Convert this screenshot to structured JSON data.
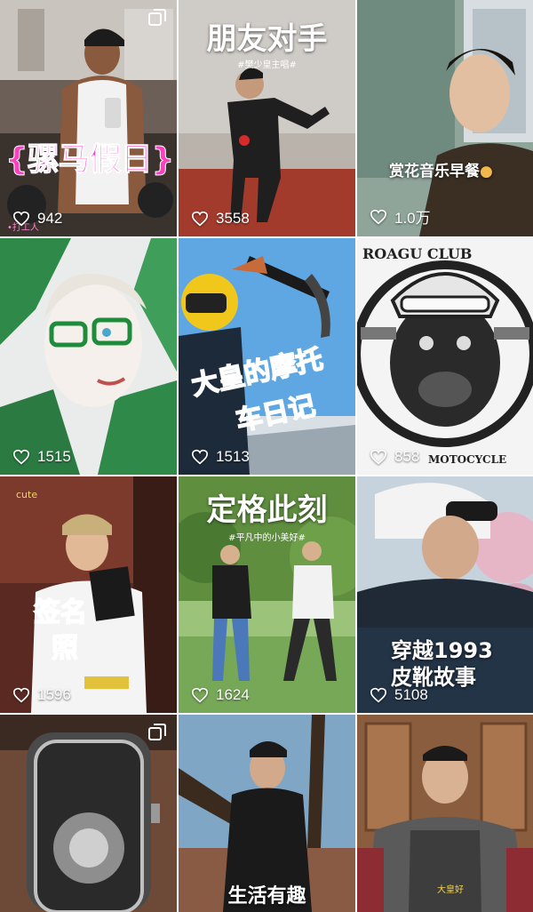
{
  "tiles": [
    {
      "likes": "942",
      "caption": "{骡马假日}",
      "corner": "•打工人",
      "multi": true
    },
    {
      "likes": "3558",
      "caption": "朋友对手",
      "subcaption": "#樊少皇主唱#",
      "multi": false
    },
    {
      "likes": "1.0万",
      "caption": "赏花音乐早餐",
      "multi": false
    },
    {
      "likes": "1515",
      "multi": false
    },
    {
      "likes": "1513",
      "caption_line1": "大皇的摩托",
      "caption_line2": "车日记",
      "multi": false
    },
    {
      "likes": "858",
      "badge_top": "ROAGU  CLUB",
      "badge_bottom": "MOTOCYCLE",
      "multi": false
    },
    {
      "likes": "1596",
      "caption_line1": "签名",
      "caption_line2": "照",
      "corner": "cute",
      "multi": false
    },
    {
      "likes": "1624",
      "caption": "定格此刻",
      "subcaption": "#平凡中的小美好#",
      "multi": false
    },
    {
      "likes": "5108",
      "caption_line1": "穿越1993",
      "caption_line2": "皮靴故事",
      "multi": false
    },
    {
      "likes": "",
      "multi": true
    },
    {
      "likes": "",
      "caption": "生活有趣",
      "multi": false
    },
    {
      "likes": "",
      "caption": "大皇好",
      "multi": false
    }
  ],
  "colors": {
    "like_text": "#ffffff",
    "pink": "#ff3fbf",
    "blue_caption": "#1e90ff",
    "red_caption": "#e8302a"
  }
}
